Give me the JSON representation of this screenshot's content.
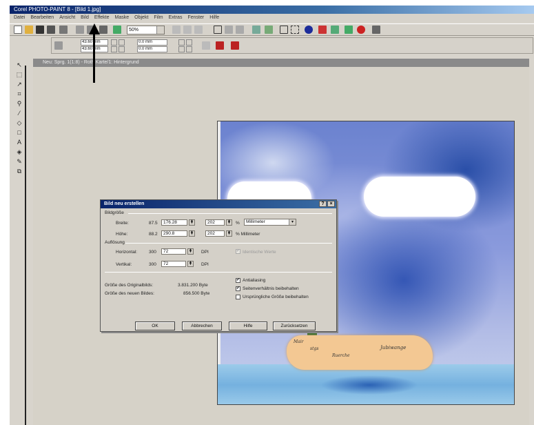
{
  "window": {
    "title": "Corel PHOTO-PAINT 8 - [Bild 1.jpg]"
  },
  "menubar": [
    "Datei",
    "Bearbeiten",
    "Ansicht",
    "Bild",
    "Effekte",
    "Maske",
    "Objekt",
    "Film",
    "Extras",
    "Fenster",
    "Hilfe"
  ],
  "toolbar": {
    "zoom_value": "50%"
  },
  "propertybar": {
    "x_value": "43.60 mm",
    "y_value": "43.60 mm",
    "w_value": "0.0 mm",
    "h_value": "0.0 mm"
  },
  "document": {
    "title": "Neu: Sprg. 1(1:8) - Roth Karte/1: Hintergrund"
  },
  "canvas": {
    "island_labels": [
      "Mair",
      "stgs",
      "Ruerche",
      "Jubiwange"
    ]
  },
  "dialog": {
    "title": "Bild neu erstellen",
    "group_size": "Bildgröße",
    "width_label": "Breite:",
    "width_orig": "87.5",
    "width_value": "176.28",
    "width_percent": "202",
    "width_unit_prefix": "%",
    "unit_selected": "Millimeter",
    "height_label": "Höhe:",
    "height_orig": "88.2",
    "height_value": "290.8",
    "height_percent": "202",
    "height_unit": "% Millimeter",
    "group_resolution": "Auflösung",
    "horiz_label": "Horizontal:",
    "horiz_orig": "300",
    "horiz_value": "72",
    "horiz_unit": "DPI",
    "identical_label": "Identische Werte",
    "vert_label": "Vertikal:",
    "vert_orig": "300",
    "vert_value": "72",
    "vert_unit": "DPI",
    "orig_size_label": "Größe des Originalbilds:",
    "orig_size_value": "3.831.200 Byte",
    "new_size_label": "Größe des neuen Bildes:",
    "new_size_value": "856.500 Byte",
    "antialias_label": "Antialiasing",
    "keep_ratio_label": "Seitenverhältnis beibehalten",
    "keep_size_label": "Ursprüngliche Größe beibehalten",
    "ok_label": "OK",
    "cancel_label": "Abbrechen",
    "help_label": "Hilfe",
    "reset_label": "Zurücksetzen",
    "close_label": "×",
    "help_q_label": "?"
  }
}
